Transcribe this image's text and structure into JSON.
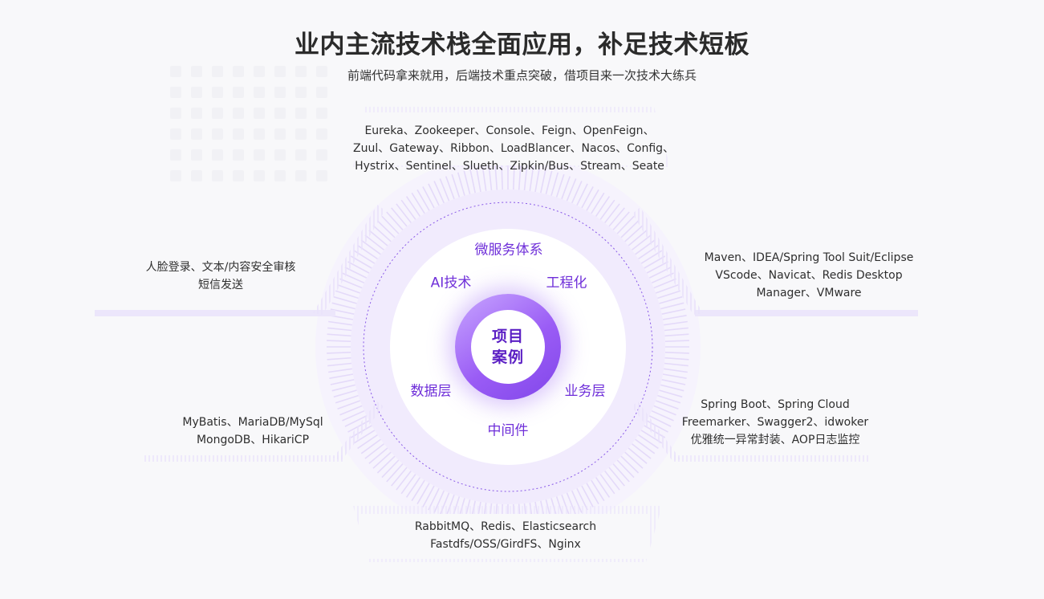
{
  "header": {
    "title": "业内主流技术栈全面应用，补足技术短板",
    "subtitle": "前端代码拿来就用，后端技术重点突破，借项目来一次技术大练兵"
  },
  "core": {
    "line1": "项目",
    "line2": "案例"
  },
  "ring_labels": {
    "microservice": "微服务体系",
    "ai": "AI技术",
    "engineering": "工程化",
    "data_layer": "数据层",
    "business_layer": "业务层",
    "middleware": "中间件"
  },
  "tech_groups": {
    "microservice": {
      "lines": [
        "Eureka、Zookeeper、Console、Feign、OpenFeign、",
        "Zuul、Gateway、Ribbon、LoadBlancer、Nacos、Config、",
        "Hystrix、Sentinel、Slueth、Zipkin/Bus、Stream、Seate"
      ]
    },
    "ai": {
      "lines": [
        "人脸登录、文本/内容安全审核",
        "短信发送"
      ]
    },
    "engineering": {
      "lines": [
        "Maven、IDEA/Spring Tool Suit/Eclipse",
        "VScode、Navicat、Redis Desktop",
        "Manager、VMware"
      ]
    },
    "data_layer": {
      "lines": [
        "MyBatis、MariaDB/MySql",
        "MongoDB、HikariCP"
      ]
    },
    "business_layer": {
      "lines": [
        "Spring Boot、Spring Cloud",
        "Freemarker、Swagger2、idwoker",
        "优雅统一异常封装、AOP日志监控"
      ]
    },
    "middleware": {
      "lines": [
        "RabbitMQ、Redis、Elasticsearch",
        "Fastdfs/OSS/GirdFS、Nginx"
      ]
    }
  },
  "colors": {
    "accent": "#6f2fd9",
    "core_gradient_start": "#c8a6ff",
    "core_gradient_end": "#8146ea",
    "ring_fill": "#f1ebfd",
    "stripe": "#e6ddfb"
  }
}
